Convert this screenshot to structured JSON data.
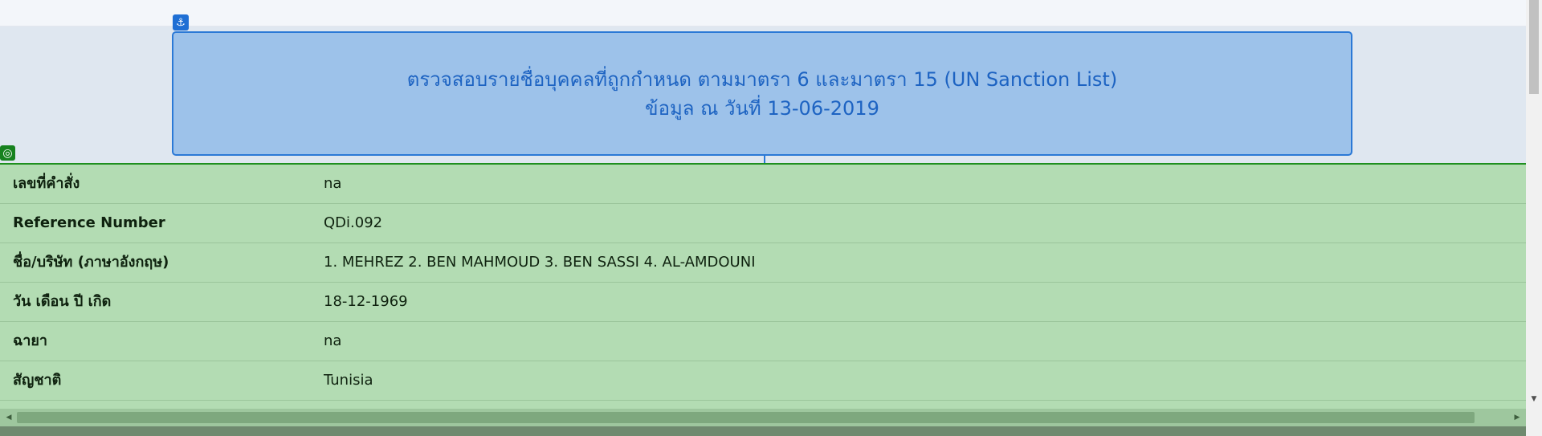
{
  "header": {
    "title_line1": "ตรวจสอบรายชื่อบุคคลที่ถูกกำหนด ตามมาตรา 6 และมาตรา 15 (UN Sanction List)",
    "title_line2": "ข้อมูล ณ วันที่ 13-06-2019"
  },
  "icons": {
    "anchor": "anchor-icon",
    "target": "target-icon"
  },
  "details": [
    {
      "label": "เลขที่คำสั่ง",
      "value": "na"
    },
    {
      "label": "Reference Number",
      "value": "QDi.092"
    },
    {
      "label": "ชื่อ/บริษัท (ภาษาอังกฤษ)",
      "value": "1. MEHREZ 2. BEN MAHMOUD 3. BEN SASSI 4. AL-AMDOUNI"
    },
    {
      "label": "วัน เดือน ปี เกิด",
      "value": "18-12-1969"
    },
    {
      "label": "ฉายา",
      "value": "na"
    },
    {
      "label": "สัญชาติ",
      "value": "Tunisia"
    }
  ],
  "colors": {
    "header_bg": "#9dc2ea",
    "header_border": "#2b79d6",
    "header_text": "#1d63c2",
    "table_bg": "#b3dcb3",
    "table_border": "#1f8f1f"
  }
}
